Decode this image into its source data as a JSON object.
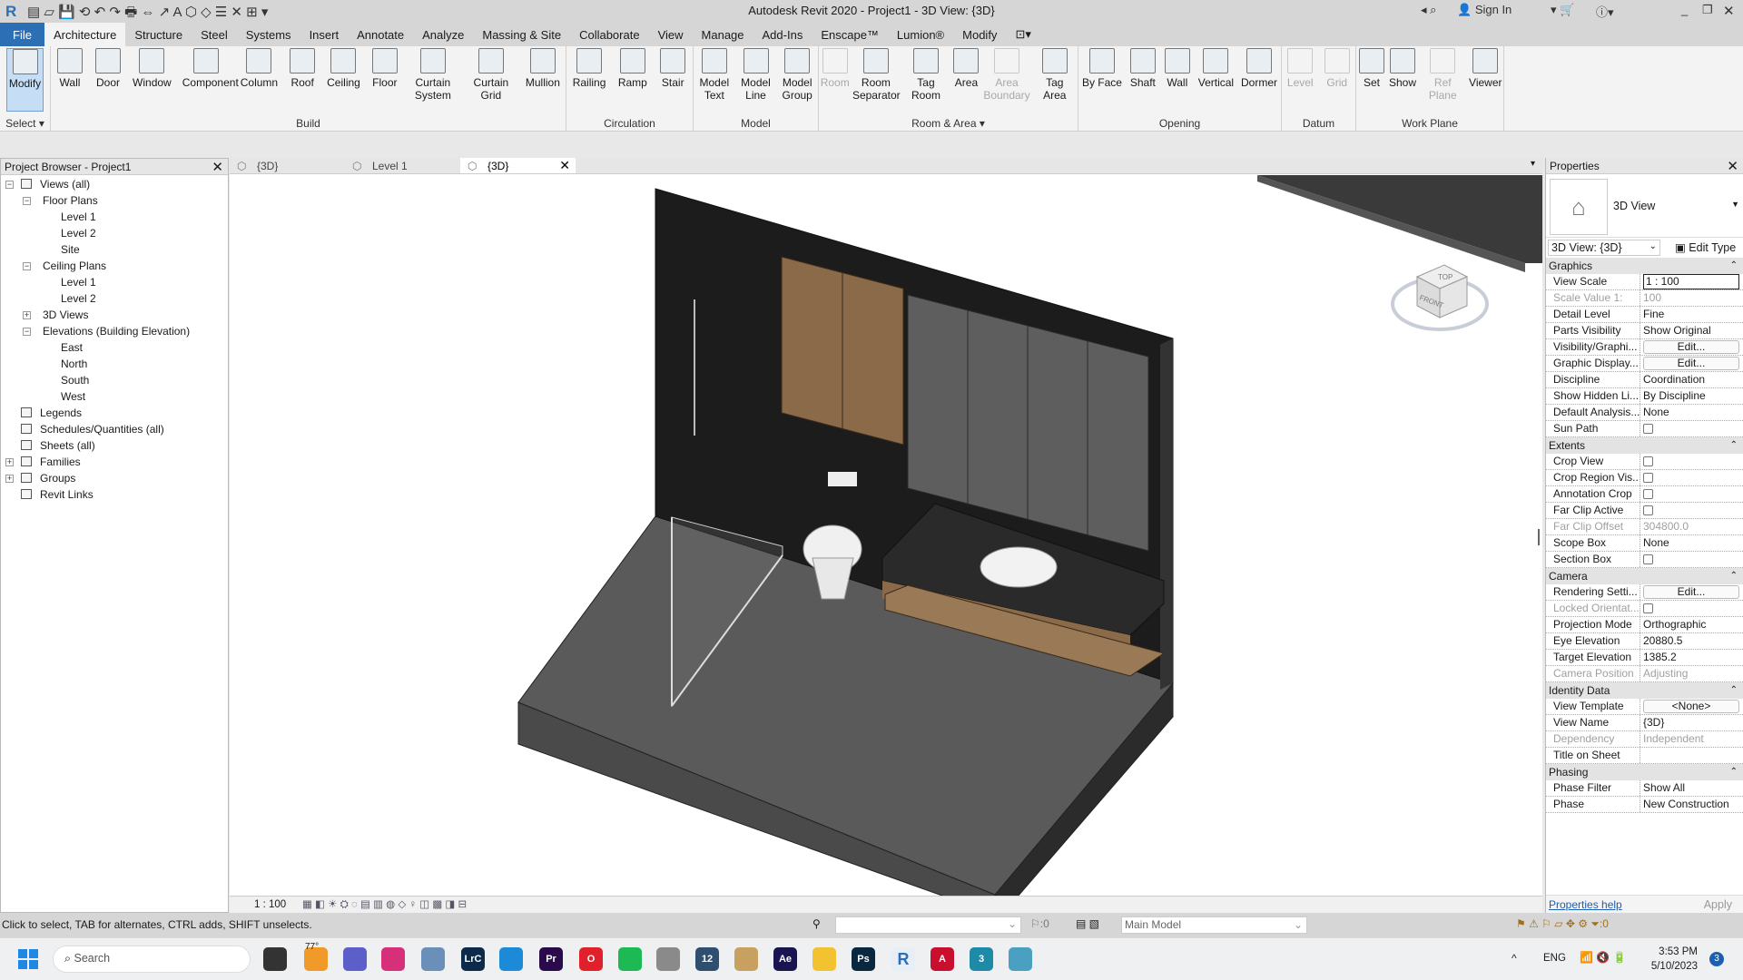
{
  "window": {
    "title": "Autodesk Revit 2020 - Project1 - 3D View: {3D}",
    "sign_in": "Sign In"
  },
  "ribbon_tabs": [
    "File",
    "Architecture",
    "Structure",
    "Steel",
    "Systems",
    "Insert",
    "Annotate",
    "Analyze",
    "Massing & Site",
    "Collaborate",
    "View",
    "Manage",
    "Add-Ins",
    "Enscape™",
    "Lumion®",
    "Modify"
  ],
  "active_tab": "Architecture",
  "ribbon_panels": [
    {
      "label": "Select ▾",
      "buttons": [
        {
          "label": "Modify",
          "selected": true
        }
      ]
    },
    {
      "label": "Build",
      "buttons": [
        {
          "label": "Wall"
        },
        {
          "label": "Door"
        },
        {
          "label": "Window"
        },
        {
          "label": "Component"
        },
        {
          "label": "Column"
        },
        {
          "label": "Roof"
        },
        {
          "label": "Ceiling"
        },
        {
          "label": "Floor"
        },
        {
          "label": "Curtain System"
        },
        {
          "label": "Curtain Grid"
        },
        {
          "label": "Mullion"
        }
      ]
    },
    {
      "label": "Circulation",
      "buttons": [
        {
          "label": "Railing"
        },
        {
          "label": "Ramp"
        },
        {
          "label": "Stair"
        }
      ]
    },
    {
      "label": "Model",
      "buttons": [
        {
          "label": "Model Text"
        },
        {
          "label": "Model Line"
        },
        {
          "label": "Model Group"
        }
      ]
    },
    {
      "label": "Room & Area ▾",
      "buttons": [
        {
          "label": "Room",
          "disabled": true
        },
        {
          "label": "Room Separator"
        },
        {
          "label": "Tag Room"
        },
        {
          "label": "Area"
        },
        {
          "label": "Area Boundary",
          "disabled": true
        },
        {
          "label": "Tag Area"
        }
      ]
    },
    {
      "label": "Opening",
      "buttons": [
        {
          "label": "By Face"
        },
        {
          "label": "Shaft"
        },
        {
          "label": "Wall"
        },
        {
          "label": "Vertical"
        },
        {
          "label": "Dormer"
        }
      ]
    },
    {
      "label": "Datum",
      "buttons": [
        {
          "label": "Level",
          "disabled": true
        },
        {
          "label": "Grid",
          "disabled": true
        }
      ]
    },
    {
      "label": "Work Plane",
      "buttons": [
        {
          "label": "Set"
        },
        {
          "label": "Show"
        },
        {
          "label": "Ref Plane",
          "disabled": true
        },
        {
          "label": "Viewer"
        }
      ]
    }
  ],
  "project_browser": {
    "title": "Project Browser - Project1",
    "items": [
      {
        "label": "Views (all)",
        "level": 0,
        "toggle": "−"
      },
      {
        "label": "Floor Plans",
        "level": 1,
        "toggle": "−"
      },
      {
        "label": "Level 1",
        "level": 2
      },
      {
        "label": "Level 2",
        "level": 2
      },
      {
        "label": "Site",
        "level": 2
      },
      {
        "label": "Ceiling Plans",
        "level": 1,
        "toggle": "−"
      },
      {
        "label": "Level 1",
        "level": 2
      },
      {
        "label": "Level 2",
        "level": 2
      },
      {
        "label": "3D Views",
        "level": 1,
        "toggle": "+"
      },
      {
        "label": "Elevations (Building Elevation)",
        "level": 1,
        "toggle": "−"
      },
      {
        "label": "East",
        "level": 2
      },
      {
        "label": "North",
        "level": 2
      },
      {
        "label": "South",
        "level": 2
      },
      {
        "label": "West",
        "level": 2
      },
      {
        "label": "Legends",
        "level": 0
      },
      {
        "label": "Schedules/Quantities (all)",
        "level": 0
      },
      {
        "label": "Sheets (all)",
        "level": 0
      },
      {
        "label": "Families",
        "level": 0,
        "toggle": "+"
      },
      {
        "label": "Groups",
        "level": 0,
        "toggle": "+"
      },
      {
        "label": "Revit Links",
        "level": 0
      }
    ]
  },
  "view_tabs": [
    {
      "label": "{3D}"
    },
    {
      "label": "Level 1"
    },
    {
      "label": "{3D}",
      "active": true
    }
  ],
  "view_control_bar": {
    "scale": "1 : 100"
  },
  "viewcube": {
    "top": "TOP",
    "front": "FRONT"
  },
  "properties": {
    "title": "Properties",
    "type_name": "3D View",
    "instance_selector": "3D View: {3D}",
    "edit_type": "Edit Type",
    "groups": [
      {
        "name": "Graphics",
        "rows": [
          {
            "name": "View Scale",
            "value": "1 : 100",
            "kind": "input"
          },
          {
            "name": "Scale Value    1:",
            "value": "100",
            "disabled": true
          },
          {
            "name": "Detail Level",
            "value": "Fine"
          },
          {
            "name": "Parts Visibility",
            "value": "Show Original"
          },
          {
            "name": "Visibility/Graphi...",
            "value": "Edit...",
            "kind": "button"
          },
          {
            "name": "Graphic Display...",
            "value": "Edit...",
            "kind": "button"
          },
          {
            "name": "Discipline",
            "value": "Coordination"
          },
          {
            "name": "Show Hidden Li...",
            "value": "By Discipline"
          },
          {
            "name": "Default Analysis...",
            "value": "None"
          },
          {
            "name": "Sun Path",
            "value": "",
            "kind": "checkbox"
          }
        ]
      },
      {
        "name": "Extents",
        "rows": [
          {
            "name": "Crop View",
            "value": "",
            "kind": "checkbox"
          },
          {
            "name": "Crop Region Vis...",
            "value": "",
            "kind": "checkbox"
          },
          {
            "name": "Annotation Crop",
            "value": "",
            "kind": "checkbox"
          },
          {
            "name": "Far Clip Active",
            "value": "",
            "kind": "checkbox"
          },
          {
            "name": "Far Clip Offset",
            "value": "304800.0",
            "disabled": true
          },
          {
            "name": "Scope Box",
            "value": "None"
          },
          {
            "name": "Section Box",
            "value": "",
            "kind": "checkbox"
          }
        ]
      },
      {
        "name": "Camera",
        "rows": [
          {
            "name": "Rendering Setti...",
            "value": "Edit...",
            "kind": "button"
          },
          {
            "name": "Locked Orientat...",
            "value": "",
            "kind": "checkbox",
            "disabled": true
          },
          {
            "name": "Projection Mode",
            "value": "Orthographic"
          },
          {
            "name": "Eye Elevation",
            "value": "20880.5"
          },
          {
            "name": "Target Elevation",
            "value": "1385.2"
          },
          {
            "name": "Camera Position",
            "value": "Adjusting",
            "disabled": true
          }
        ]
      },
      {
        "name": "Identity Data",
        "rows": [
          {
            "name": "View Template",
            "value": "<None>",
            "kind": "button"
          },
          {
            "name": "View Name",
            "value": "{3D}"
          },
          {
            "name": "Dependency",
            "value": "Independent",
            "disabled": true
          },
          {
            "name": "Title on Sheet",
            "value": ""
          }
        ]
      },
      {
        "name": "Phasing",
        "rows": [
          {
            "name": "Phase Filter",
            "value": "Show All"
          },
          {
            "name": "Phase",
            "value": "New Construction"
          }
        ]
      }
    ],
    "help_link": "Properties help",
    "apply": "Apply"
  },
  "status_bar": {
    "message": "Click to select, TAB for alternates, CTRL adds, SHIFT unselects.",
    "workset_count": ":0",
    "model": "Main Model",
    "filter_count": ":0"
  },
  "taskbar": {
    "search_placeholder": "Search",
    "weather": "77°",
    "apps": [
      {
        "label": "",
        "color": "#333333"
      },
      {
        "label": "",
        "color": "#f09a2a"
      },
      {
        "label": "",
        "color": "#5b5fc7"
      },
      {
        "label": "",
        "color": "#d6307a"
      },
      {
        "label": "",
        "color": "#6a8fb8"
      },
      {
        "label": "LrC",
        "color": "#0d2a4a"
      },
      {
        "label": "",
        "color": "#1c8ad6"
      },
      {
        "label": "Pr",
        "color": "#2a0a4a"
      },
      {
        "label": "O",
        "color": "#e0202a"
      },
      {
        "label": "",
        "color": "#1db954"
      },
      {
        "label": "",
        "color": "#8a8a8a"
      },
      {
        "label": "12",
        "color": "#2f4f6f"
      },
      {
        "label": "",
        "color": "#c8a060"
      },
      {
        "label": "Ae",
        "color": "#1a1550"
      },
      {
        "label": "",
        "color": "#f2c230"
      },
      {
        "label": "Ps",
        "color": "#0a2740"
      },
      {
        "label": "R",
        "color": "#e8eef5"
      },
      {
        "label": "A",
        "color": "#c8102e"
      },
      {
        "label": "3",
        "color": "#1f8aa8"
      },
      {
        "label": "",
        "color": "#4aa0c0"
      }
    ],
    "language": "ENG",
    "time": "3:53 PM",
    "date": "5/10/2023",
    "notifications": "3"
  }
}
